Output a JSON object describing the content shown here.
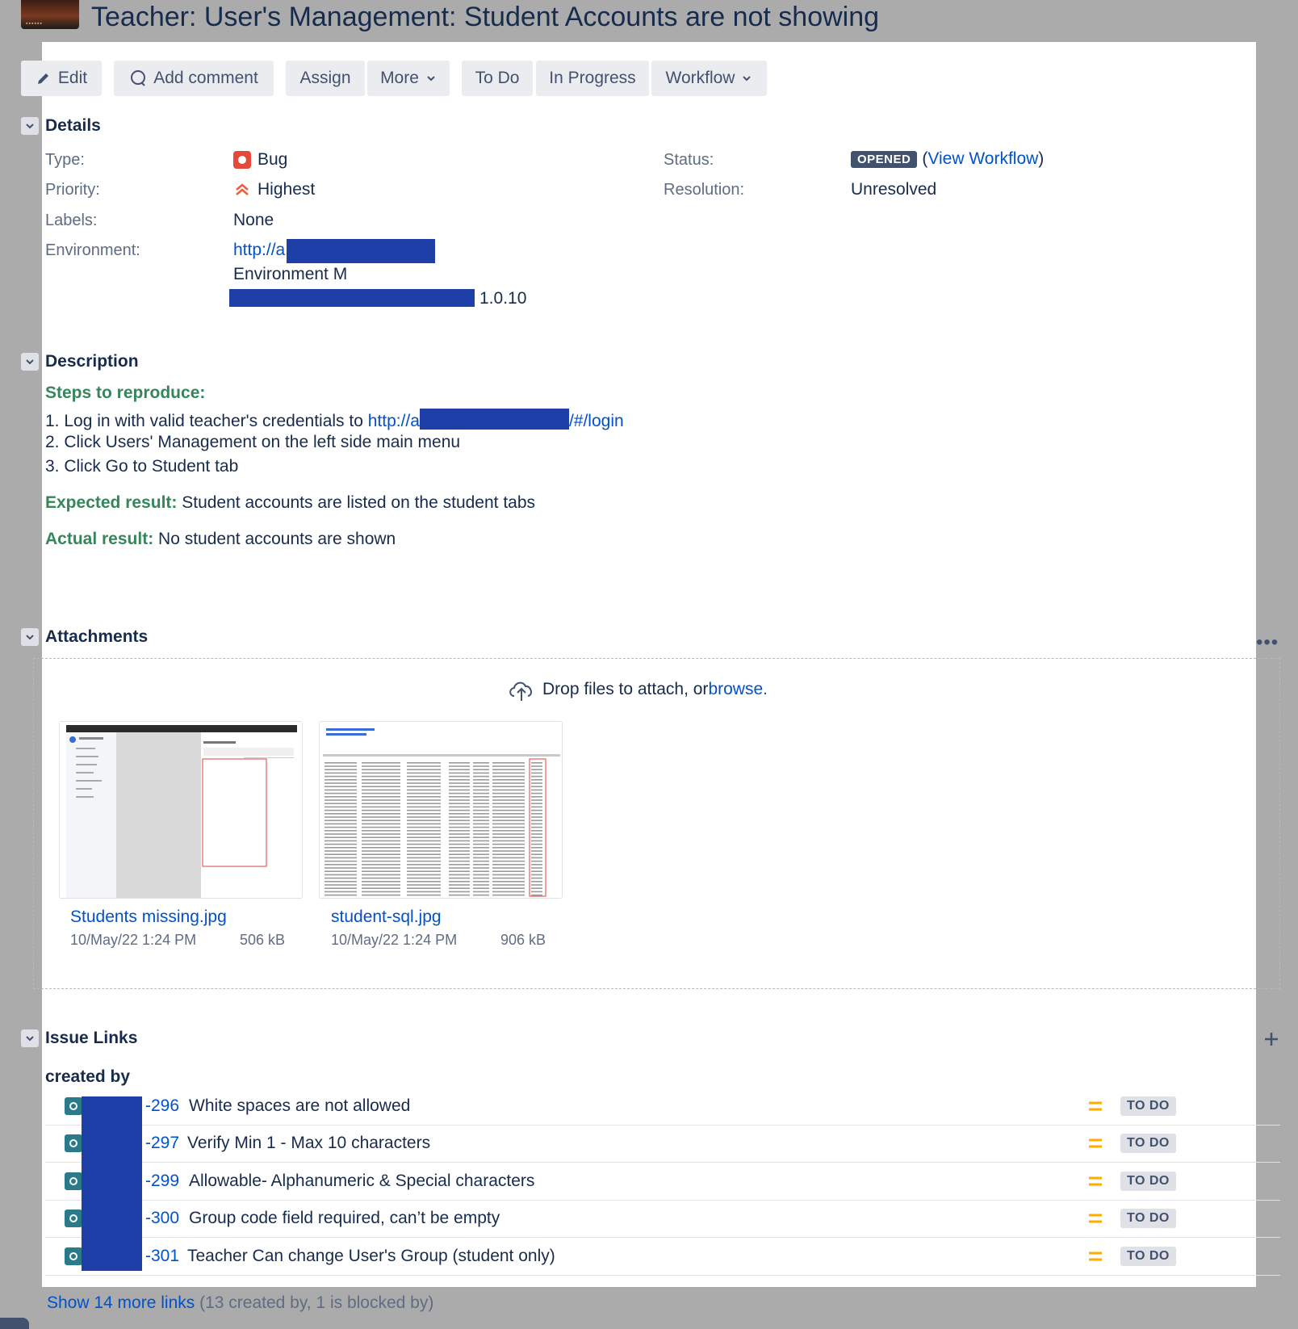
{
  "issue": {
    "title": "Teacher: User's Management: Student Accounts are not showing"
  },
  "toolbar": {
    "edit": "Edit",
    "add_comment": "Add comment",
    "assign": "Assign",
    "more": "More",
    "to_do": "To Do",
    "in_progress": "In Progress",
    "workflow": "Workflow"
  },
  "details": {
    "title": "Details",
    "type_label": "Type:",
    "type_value": "Bug",
    "priority_label": "Priority:",
    "priority_value": "Highest",
    "labels_label": "Labels:",
    "labels_value": "None",
    "environment_label": "Environment:",
    "environment_link": "http://a",
    "environment_line2": "Environment M",
    "environment_version": "1.0.10",
    "status_label": "Status:",
    "status_value": "OPENED",
    "view_workflow": "View Workflow",
    "resolution_label": "Resolution:",
    "resolution_value": "Unresolved"
  },
  "description": {
    "title": "Description",
    "steps_heading": "Steps to reproduce:",
    "step1_text": "1. Log in with valid teacher's credentials to ",
    "step1_link_start": "http://a",
    "step1_link_end": "/#/login",
    "step2": "2. Click Users' Management on the left side main menu",
    "step3": "3. Click Go to Student tab",
    "expected_label": "Expected result:",
    "expected_text": "Student accounts are listed on the student tabs",
    "actual_label": "Actual result:",
    "actual_text": "No student accounts are shown"
  },
  "attachments": {
    "title": "Attachments",
    "drop_text": "Drop files to attach, or ",
    "browse": "browse.",
    "files": [
      {
        "name": "Students missing.jpg",
        "date": "10/May/22 1:24 PM",
        "size": "506 kB"
      },
      {
        "name": "student-sql.jpg",
        "date": "10/May/22 1:24 PM",
        "size": "906 kB"
      }
    ]
  },
  "issue_links": {
    "title": "Issue Links",
    "group": "created by",
    "items": [
      {
        "key": "-296",
        "summary": "White spaces are not allowed",
        "status": "TO DO"
      },
      {
        "key": "-297",
        "summary": "Verify Min 1 - Max 10 characters",
        "status": "TO DO"
      },
      {
        "key": "-299",
        "summary": "Allowable- Alphanumeric & Special characters",
        "status": "TO DO"
      },
      {
        "key": "-300",
        "summary": "Group code field required, can’t be empty",
        "status": "TO DO"
      },
      {
        "key": "-301",
        "summary": "Teacher Can change User's Group (student only)",
        "status": "TO DO"
      }
    ],
    "show_more": "Show 14 more links",
    "show_more_detail": "(13 created by, 1 is blocked by)"
  },
  "colors": {
    "link": "#0052cc",
    "green": "#36865b",
    "bug": "#e5493a",
    "priority": "#f15c3c",
    "medium": "#ffab00",
    "redaction": "#1f3fa8"
  }
}
